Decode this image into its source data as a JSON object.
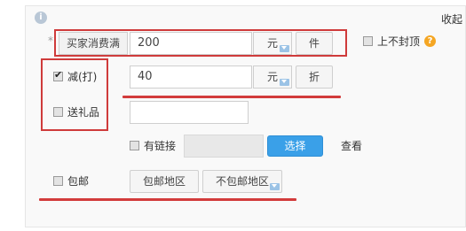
{
  "header": {
    "info_icon": "info-icon",
    "collapse_label": "收起"
  },
  "row1": {
    "label": "买家消费满",
    "amount": "200",
    "unit_label": "元",
    "alt_unit_label": "件"
  },
  "top_checkbox": {
    "label": "上不封顶",
    "help_icon": "help-icon",
    "help_glyph": "?"
  },
  "discount": {
    "checkbox_label": "减(打)",
    "checked": true,
    "amount": "40",
    "unit_label": "元",
    "alt_unit_label": "折"
  },
  "gift": {
    "checkbox_label": "送礼品",
    "input_value": ""
  },
  "link": {
    "checkbox_label": "有链接",
    "select_label": "选择",
    "view_label": "查看"
  },
  "shipping": {
    "checkbox_label": "包邮",
    "region_btn": "包邮地区",
    "no_region_btn": "不包邮地区"
  },
  "colors": {
    "accent": "#3aa0e8",
    "annotation_red": "#d23b3b",
    "link": "#1d64b4"
  }
}
